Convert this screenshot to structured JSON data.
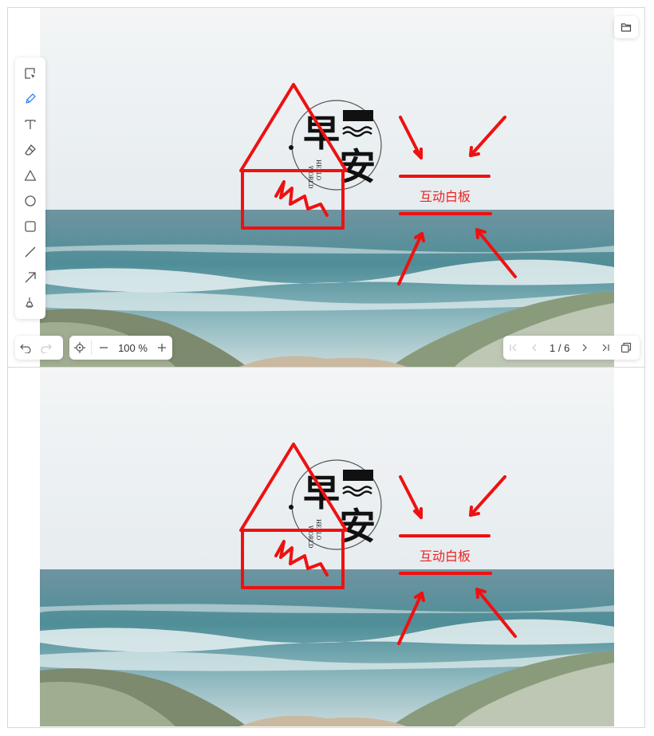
{
  "board": {
    "stamp_char_1": "早",
    "stamp_char_2": "安",
    "stamp_sub_1": "HELLO",
    "stamp_sub_2": "WORLD",
    "annotation_text": "互动白板"
  },
  "toolbar": {
    "tools": [
      "select",
      "pencil",
      "text",
      "eraser",
      "triangle",
      "circle",
      "rectangle",
      "line",
      "arrow",
      "clear"
    ],
    "active_tool": "pencil"
  },
  "zoom": {
    "value": "100 %"
  },
  "pager": {
    "label": "1 / 6"
  },
  "colors": {
    "accent": "#3b82f6",
    "ink": "#ee1111",
    "toolbar_icon": "#555555"
  }
}
